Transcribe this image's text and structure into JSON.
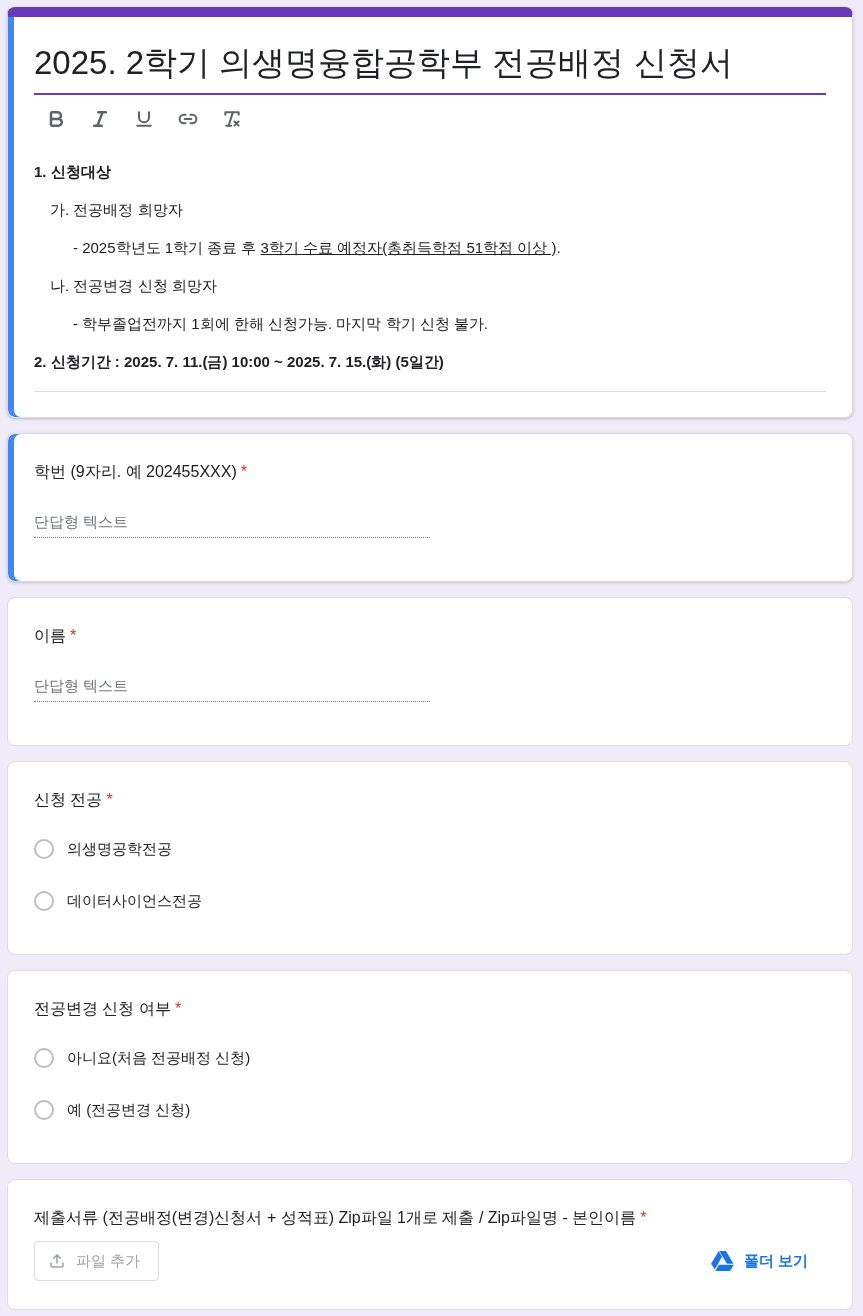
{
  "form_header": {
    "selected": true,
    "title": "2025. 2학기 의생명융합공학부 전공배정 신청서",
    "description": [
      {
        "segments": [
          {
            "text": "1. 신청대상",
            "underlined": false
          }
        ],
        "children": [
          {
            "segments": [
              {
                "text": "가. 전공배정 희망자",
                "underlined": false
              }
            ],
            "children": [
              {
                "segments": [
                  {
                    "text": "- 2025학년도 1학기 종료 후 ",
                    "underlined": false
                  },
                  {
                    "text": "3학기 수료 예정자(총취득학점 51학점 이상 )",
                    "underlined": true
                  },
                  {
                    "text": ".",
                    "underlined": false
                  }
                ]
              }
            ]
          },
          {
            "segments": [
              {
                "text": "나. 전공변경 신청 희망자",
                "underlined": false
              }
            ],
            "children": [
              {
                "segments": [
                  {
                    "text": "- 학부졸업전까지 1회에 한해 신청가능. 마지막 학기 신청 불가.",
                    "underlined": false
                  }
                ]
              }
            ]
          }
        ]
      },
      {
        "segments": [
          {
            "text": "2. 신청기간 : 2025. 7. 11.(금) 10:00 ~ 2025. 7. 15.(화) (5일간)",
            "underlined": false
          }
        ]
      }
    ]
  },
  "questions": [
    {
      "kind": "short_text",
      "selected": true,
      "title": "학번 (9자리. 예 202455XXX)",
      "required_mark": "*",
      "placeholder": "단답형 텍스트"
    },
    {
      "kind": "short_text",
      "selected": false,
      "title": "이름",
      "required_mark": "*",
      "placeholder": "단답형 텍스트"
    },
    {
      "kind": "multiple_choice",
      "selected": false,
      "title": "신청 전공",
      "required_mark": "*",
      "options": [
        {
          "label": "의생명공학전공",
          "checked": false
        },
        {
          "label": "데이터사이언스전공",
          "checked": false
        }
      ]
    },
    {
      "kind": "multiple_choice",
      "selected": false,
      "title": "전공변경 신청 여부",
      "required_mark": "*",
      "options": [
        {
          "label": "아니요(처음 전공배정 신청)",
          "checked": false
        },
        {
          "label": "예 (전공변경 신청)",
          "checked": false
        }
      ]
    },
    {
      "kind": "file_upload",
      "selected": false,
      "title": "제출서류 (전공배정(변경)신청서 + 성적표) Zip파일 1개로 제출 / Zip파일명 - 본인이름",
      "required_mark": "*",
      "upload_button": {
        "label": "파일 추가",
        "disabled": true
      },
      "folder_link": "폴더 보기"
    }
  ]
}
